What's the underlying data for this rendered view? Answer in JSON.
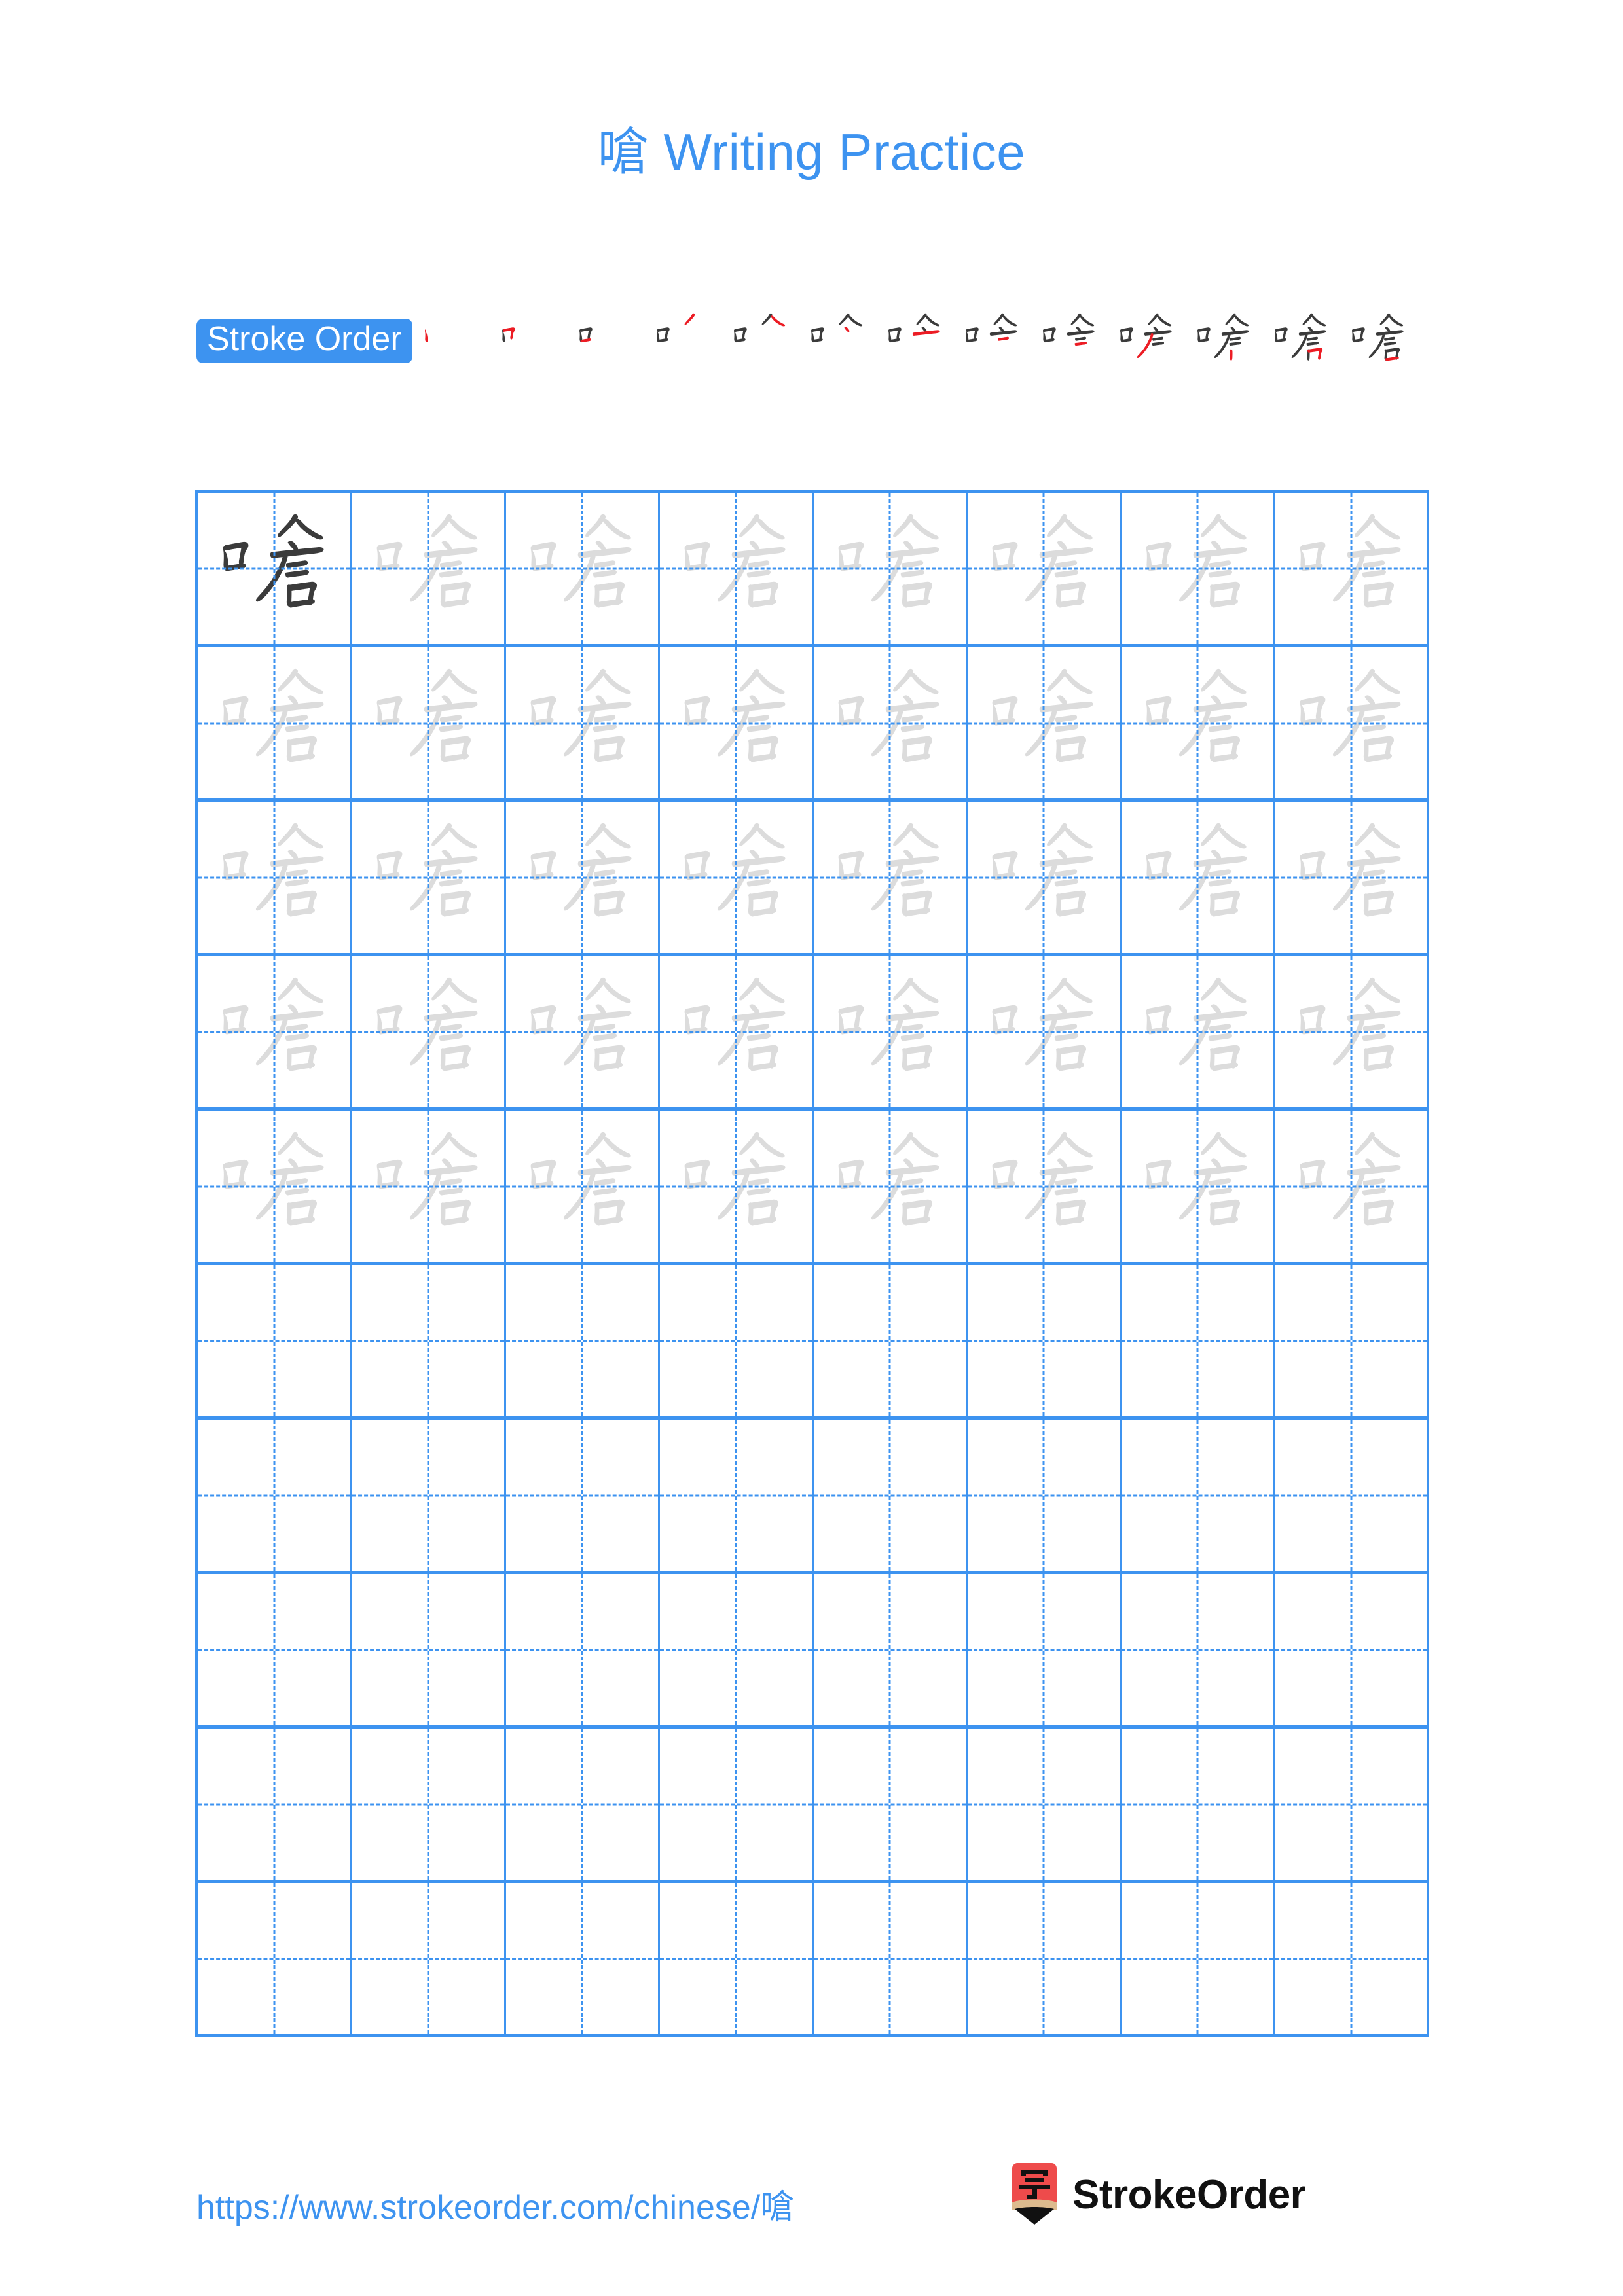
{
  "page": {
    "character": "嗆",
    "title": "嗆 Writing Practice",
    "background_color": "#ffffff",
    "accent_color": "#3d93f0",
    "new_stroke_color": "#ec1c24",
    "done_stroke_color": "#3b3b3b",
    "trace_glyph_color": "#dcdcdc",
    "model_glyph_color": "#3b3b3b"
  },
  "stroke_order": {
    "badge_label": "Stroke Order",
    "total_strokes": 13,
    "steps": [
      {
        "index": 1,
        "strokes_shown": 1,
        "new_stroke": 1
      },
      {
        "index": 2,
        "strokes_shown": 2,
        "new_stroke": 2
      },
      {
        "index": 3,
        "strokes_shown": 3,
        "new_stroke": 3
      },
      {
        "index": 4,
        "strokes_shown": 4,
        "new_stroke": 4
      },
      {
        "index": 5,
        "strokes_shown": 5,
        "new_stroke": 5
      },
      {
        "index": 6,
        "strokes_shown": 6,
        "new_stroke": 6
      },
      {
        "index": 7,
        "strokes_shown": 7,
        "new_stroke": 7
      },
      {
        "index": 8,
        "strokes_shown": 8,
        "new_stroke": 8
      },
      {
        "index": 9,
        "strokes_shown": 9,
        "new_stroke": 9
      },
      {
        "index": 10,
        "strokes_shown": 10,
        "new_stroke": 10
      },
      {
        "index": 11,
        "strokes_shown": 11,
        "new_stroke": 11
      },
      {
        "index": 12,
        "strokes_shown": 12,
        "new_stroke": 12
      },
      {
        "index": 13,
        "strokes_shown": 13,
        "new_stroke": 13
      }
    ]
  },
  "grid": {
    "columns": 8,
    "rows": 10,
    "filled_rows": 5,
    "empty_rows": 5,
    "cells": [
      [
        "model",
        "trace",
        "trace",
        "trace",
        "trace",
        "trace",
        "trace",
        "trace"
      ],
      [
        "trace",
        "trace",
        "trace",
        "trace",
        "trace",
        "trace",
        "trace",
        "trace"
      ],
      [
        "trace",
        "trace",
        "trace",
        "trace",
        "trace",
        "trace",
        "trace",
        "trace"
      ],
      [
        "trace",
        "trace",
        "trace",
        "trace",
        "trace",
        "trace",
        "trace",
        "trace"
      ],
      [
        "trace",
        "trace",
        "trace",
        "trace",
        "trace",
        "trace",
        "trace",
        "trace"
      ],
      [
        "empty",
        "empty",
        "empty",
        "empty",
        "empty",
        "empty",
        "empty",
        "empty"
      ],
      [
        "empty",
        "empty",
        "empty",
        "empty",
        "empty",
        "empty",
        "empty",
        "empty"
      ],
      [
        "empty",
        "empty",
        "empty",
        "empty",
        "empty",
        "empty",
        "empty",
        "empty"
      ],
      [
        "empty",
        "empty",
        "empty",
        "empty",
        "empty",
        "empty",
        "empty",
        "empty"
      ],
      [
        "empty",
        "empty",
        "empty",
        "empty",
        "empty",
        "empty",
        "empty",
        "empty"
      ]
    ]
  },
  "footer": {
    "url": "https://www.strokeorder.com/chinese/嗆",
    "brand_name": "StrokeOrder",
    "logo_character": "字",
    "logo_body_color": "#ee4b4b",
    "logo_wood_color": "#ddbb8e",
    "logo_tip_color": "#111111"
  }
}
